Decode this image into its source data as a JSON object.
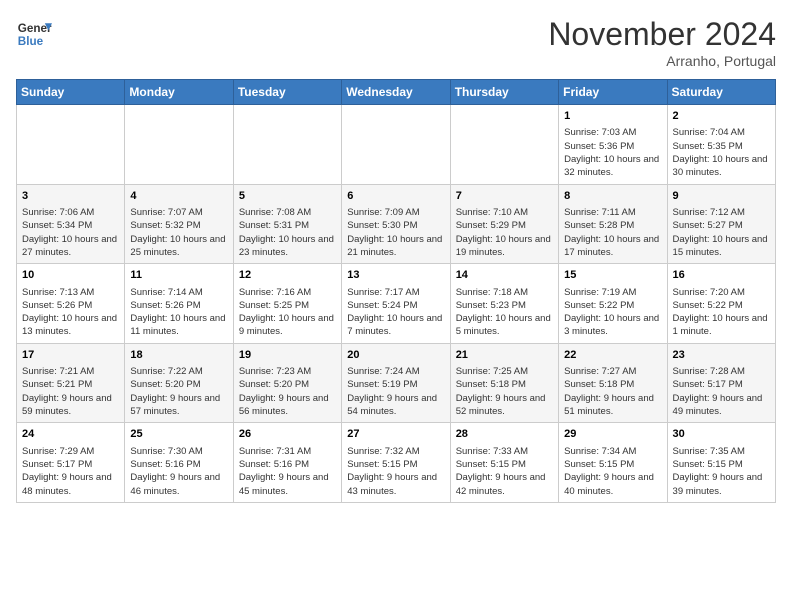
{
  "header": {
    "logo_line1": "General",
    "logo_line2": "Blue",
    "month": "November 2024",
    "location": "Arranho, Portugal"
  },
  "weekdays": [
    "Sunday",
    "Monday",
    "Tuesday",
    "Wednesday",
    "Thursday",
    "Friday",
    "Saturday"
  ],
  "weeks": [
    [
      {
        "day": "",
        "info": ""
      },
      {
        "day": "",
        "info": ""
      },
      {
        "day": "",
        "info": ""
      },
      {
        "day": "",
        "info": ""
      },
      {
        "day": "",
        "info": ""
      },
      {
        "day": "1",
        "info": "Sunrise: 7:03 AM\nSunset: 5:36 PM\nDaylight: 10 hours and 32 minutes."
      },
      {
        "day": "2",
        "info": "Sunrise: 7:04 AM\nSunset: 5:35 PM\nDaylight: 10 hours and 30 minutes."
      }
    ],
    [
      {
        "day": "3",
        "info": "Sunrise: 7:06 AM\nSunset: 5:34 PM\nDaylight: 10 hours and 27 minutes."
      },
      {
        "day": "4",
        "info": "Sunrise: 7:07 AM\nSunset: 5:32 PM\nDaylight: 10 hours and 25 minutes."
      },
      {
        "day": "5",
        "info": "Sunrise: 7:08 AM\nSunset: 5:31 PM\nDaylight: 10 hours and 23 minutes."
      },
      {
        "day": "6",
        "info": "Sunrise: 7:09 AM\nSunset: 5:30 PM\nDaylight: 10 hours and 21 minutes."
      },
      {
        "day": "7",
        "info": "Sunrise: 7:10 AM\nSunset: 5:29 PM\nDaylight: 10 hours and 19 minutes."
      },
      {
        "day": "8",
        "info": "Sunrise: 7:11 AM\nSunset: 5:28 PM\nDaylight: 10 hours and 17 minutes."
      },
      {
        "day": "9",
        "info": "Sunrise: 7:12 AM\nSunset: 5:27 PM\nDaylight: 10 hours and 15 minutes."
      }
    ],
    [
      {
        "day": "10",
        "info": "Sunrise: 7:13 AM\nSunset: 5:26 PM\nDaylight: 10 hours and 13 minutes."
      },
      {
        "day": "11",
        "info": "Sunrise: 7:14 AM\nSunset: 5:26 PM\nDaylight: 10 hours and 11 minutes."
      },
      {
        "day": "12",
        "info": "Sunrise: 7:16 AM\nSunset: 5:25 PM\nDaylight: 10 hours and 9 minutes."
      },
      {
        "day": "13",
        "info": "Sunrise: 7:17 AM\nSunset: 5:24 PM\nDaylight: 10 hours and 7 minutes."
      },
      {
        "day": "14",
        "info": "Sunrise: 7:18 AM\nSunset: 5:23 PM\nDaylight: 10 hours and 5 minutes."
      },
      {
        "day": "15",
        "info": "Sunrise: 7:19 AM\nSunset: 5:22 PM\nDaylight: 10 hours and 3 minutes."
      },
      {
        "day": "16",
        "info": "Sunrise: 7:20 AM\nSunset: 5:22 PM\nDaylight: 10 hours and 1 minute."
      }
    ],
    [
      {
        "day": "17",
        "info": "Sunrise: 7:21 AM\nSunset: 5:21 PM\nDaylight: 9 hours and 59 minutes."
      },
      {
        "day": "18",
        "info": "Sunrise: 7:22 AM\nSunset: 5:20 PM\nDaylight: 9 hours and 57 minutes."
      },
      {
        "day": "19",
        "info": "Sunrise: 7:23 AM\nSunset: 5:20 PM\nDaylight: 9 hours and 56 minutes."
      },
      {
        "day": "20",
        "info": "Sunrise: 7:24 AM\nSunset: 5:19 PM\nDaylight: 9 hours and 54 minutes."
      },
      {
        "day": "21",
        "info": "Sunrise: 7:25 AM\nSunset: 5:18 PM\nDaylight: 9 hours and 52 minutes."
      },
      {
        "day": "22",
        "info": "Sunrise: 7:27 AM\nSunset: 5:18 PM\nDaylight: 9 hours and 51 minutes."
      },
      {
        "day": "23",
        "info": "Sunrise: 7:28 AM\nSunset: 5:17 PM\nDaylight: 9 hours and 49 minutes."
      }
    ],
    [
      {
        "day": "24",
        "info": "Sunrise: 7:29 AM\nSunset: 5:17 PM\nDaylight: 9 hours and 48 minutes."
      },
      {
        "day": "25",
        "info": "Sunrise: 7:30 AM\nSunset: 5:16 PM\nDaylight: 9 hours and 46 minutes."
      },
      {
        "day": "26",
        "info": "Sunrise: 7:31 AM\nSunset: 5:16 PM\nDaylight: 9 hours and 45 minutes."
      },
      {
        "day": "27",
        "info": "Sunrise: 7:32 AM\nSunset: 5:15 PM\nDaylight: 9 hours and 43 minutes."
      },
      {
        "day": "28",
        "info": "Sunrise: 7:33 AM\nSunset: 5:15 PM\nDaylight: 9 hours and 42 minutes."
      },
      {
        "day": "29",
        "info": "Sunrise: 7:34 AM\nSunset: 5:15 PM\nDaylight: 9 hours and 40 minutes."
      },
      {
        "day": "30",
        "info": "Sunrise: 7:35 AM\nSunset: 5:15 PM\nDaylight: 9 hours and 39 minutes."
      }
    ]
  ]
}
